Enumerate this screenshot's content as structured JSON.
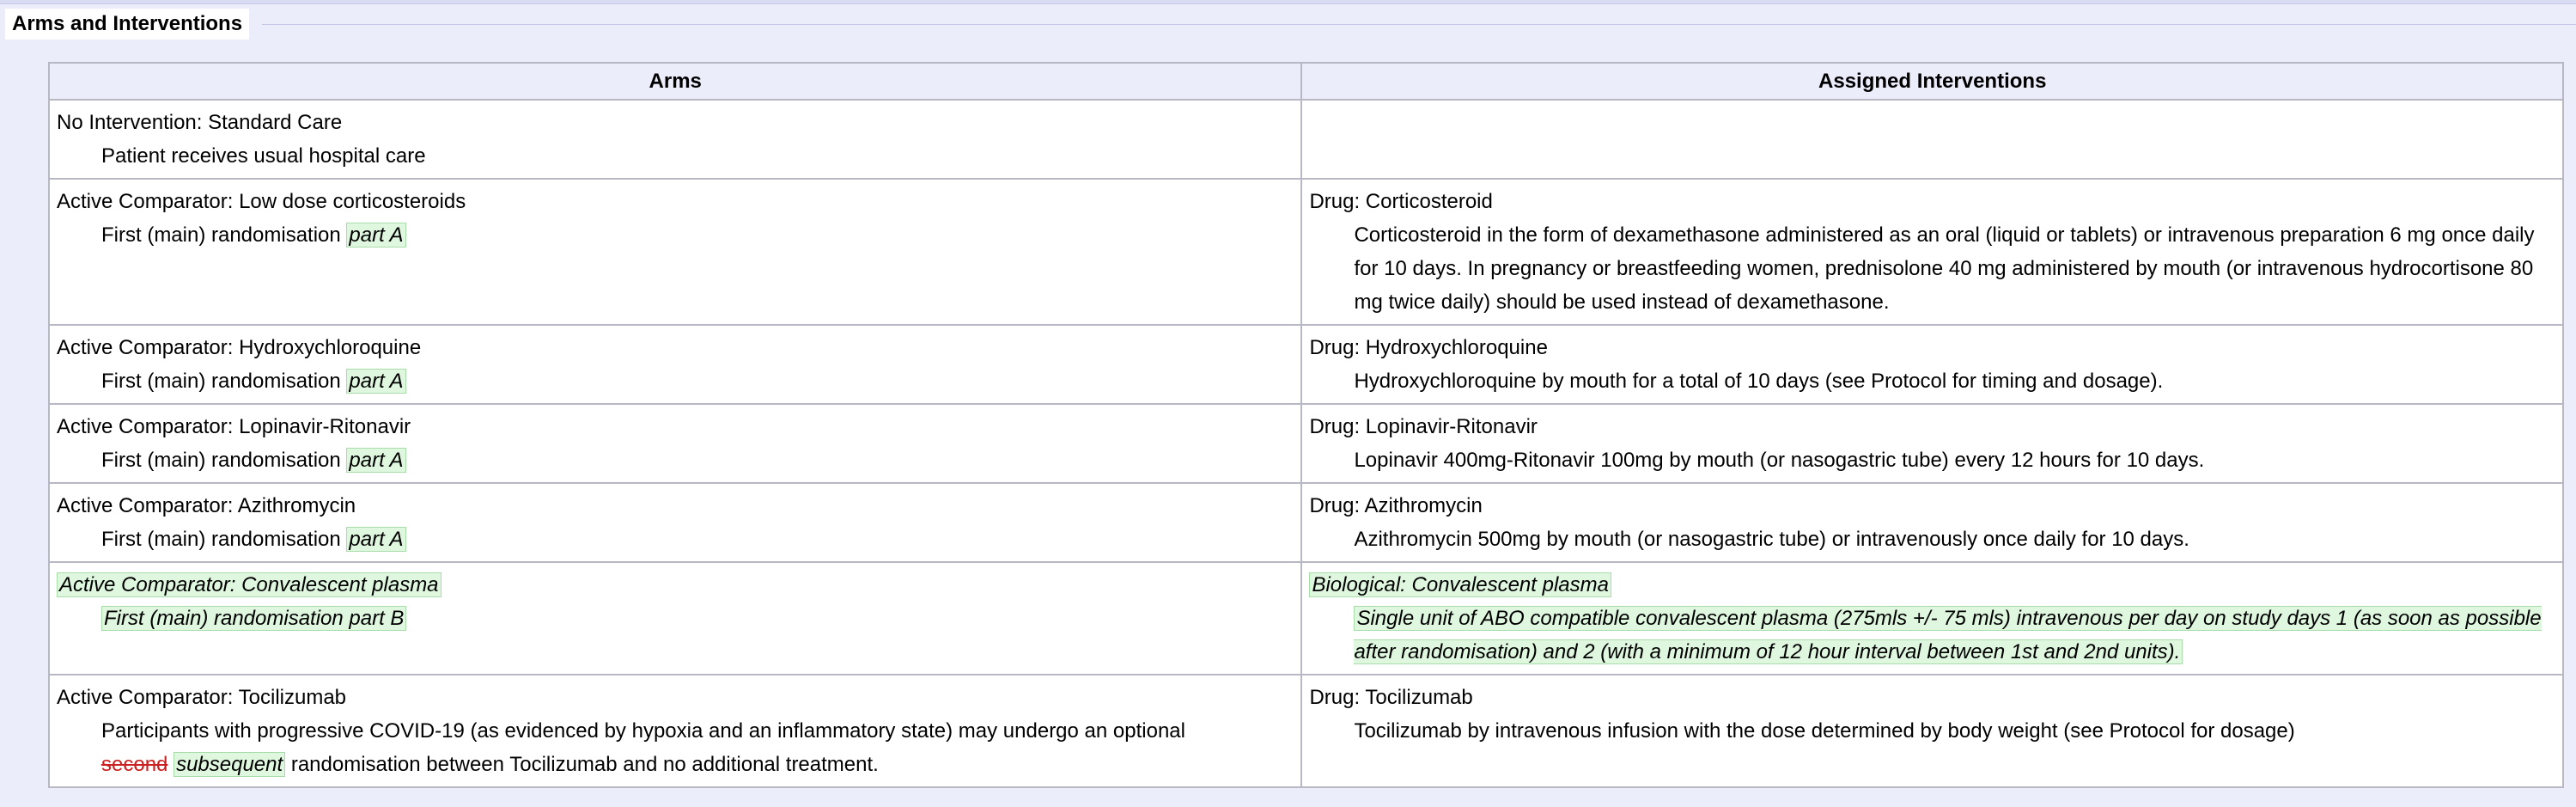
{
  "section": {
    "title": "Arms and Interventions"
  },
  "table": {
    "headers": {
      "arms": "Arms",
      "interventions": "Assigned Interventions"
    },
    "rows": [
      {
        "arm_label": "No Intervention: Standard Care",
        "arm_desc": "Patient receives usual hospital care",
        "int_label": "",
        "int_desc": ""
      },
      {
        "arm_label": "Active Comparator: Low dose corticosteroids",
        "arm_desc": "First (main) randomisation",
        "arm_desc_ins": "part A",
        "int_label": "Drug: Corticosteroid",
        "int_desc": "Corticosteroid in the form of dexamethasone administered as an oral (liquid or tablets) or intravenous preparation 6 mg once daily for 10 days. In pregnancy or breastfeeding women, prednisolone 40 mg administered by mouth (or intravenous hydrocortisone 80 mg twice daily) should be used instead of dexamethasone."
      },
      {
        "arm_label": "Active Comparator: Hydroxychloroquine",
        "arm_desc": "First (main) randomisation",
        "arm_desc_ins": "part A",
        "int_label": "Drug: Hydroxychloroquine",
        "int_desc": "Hydroxychloroquine by mouth for a total of 10 days (see Protocol for timing and dosage)."
      },
      {
        "arm_label": "Active Comparator: Lopinavir-Ritonavir",
        "arm_desc": "First (main) randomisation",
        "arm_desc_ins": "part A",
        "int_label": "Drug: Lopinavir-Ritonavir",
        "int_desc": "Lopinavir 400mg-Ritonavir 100mg by mouth (or nasogastric tube) every 12 hours for 10 days."
      },
      {
        "arm_label": "Active Comparator: Azithromycin",
        "arm_desc": "First (main) randomisation",
        "arm_desc_ins": "part A",
        "int_label": "Drug: Azithromycin",
        "int_desc": "Azithromycin 500mg by mouth (or nasogastric tube) or intravenously once daily for 10 days."
      },
      {
        "arm_label": "Active Comparator: Convalescent plasma",
        "arm_desc": "First (main) randomisation part B",
        "int_label": "Biological: Convalescent plasma",
        "int_desc": "Single unit of ABO compatible convalescent plasma (275mls +/- 75 mls) intravenous per day on study days 1 (as soon as possible after randomisation) and 2 (with a minimum of 12 hour interval between 1st and 2nd units)."
      },
      {
        "arm_label": "Active Comparator: Tocilizumab",
        "arm_desc": "Participants with progressive COVID-19 (as evidenced by hypoxia and an inflammatory state) may undergo an optional",
        "arm_desc_del": "second",
        "arm_desc_ins": "subsequent",
        "arm_desc_tail": "randomisation between Tocilizumab and no additional treatment.",
        "int_label": "Drug: Tocilizumab",
        "int_desc": "Tocilizumab by intravenous infusion with the dose determined by body weight (see Protocol for dosage)"
      }
    ]
  },
  "colors": {
    "page_bg": "#ecedfb",
    "header_bg": "#ecedfb",
    "inserted_bg": "#dff7df",
    "deleted_text": "#cc1f1f",
    "border": "#b8b8c4"
  }
}
